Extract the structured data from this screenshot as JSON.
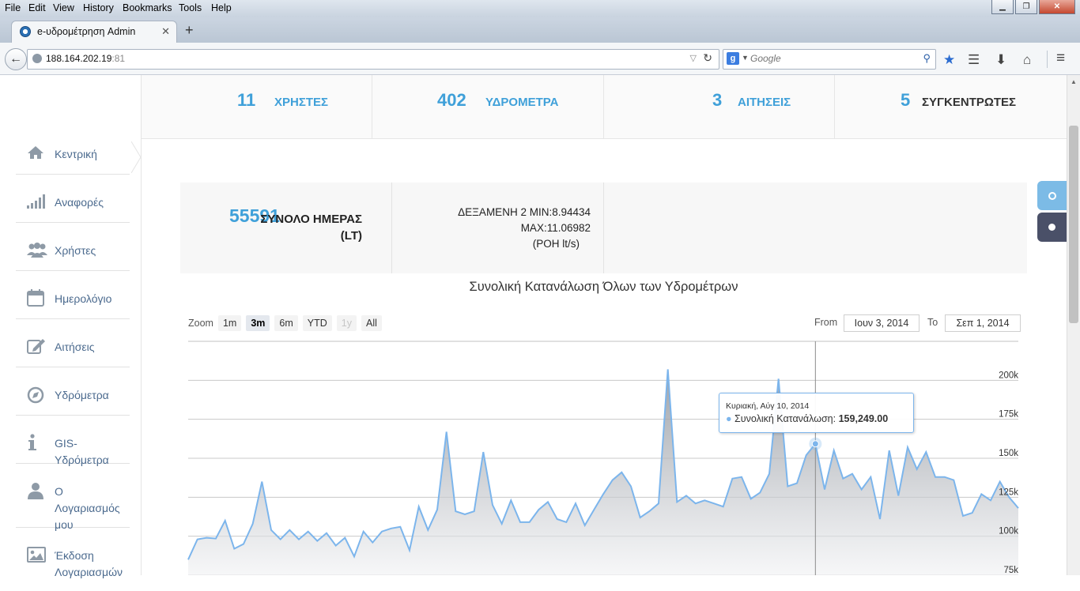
{
  "browser": {
    "menu": [
      "File",
      "Edit",
      "View",
      "History",
      "Bookmarks",
      "Tools",
      "Help"
    ],
    "tab_title": "e-υδρομέτρηση Admin",
    "url_host": "188.164.202.19",
    "url_port": ":81",
    "search_placeholder": "Google"
  },
  "stats": [
    {
      "num": "11",
      "label": "ΧΡΗΣΤΕΣ"
    },
    {
      "num": "402",
      "label": "ΥΔΡΟΜΕΤΡΑ"
    },
    {
      "num": "3",
      "label": "ΑΙΤΗΣΕΙΣ"
    },
    {
      "num": "5",
      "label": "ΣΥΓΚΕΝΤΡΩΤΕΣ"
    }
  ],
  "sidebar": [
    {
      "label": "Κεντρική",
      "icon": "home-icon"
    },
    {
      "label": "Αναφορές",
      "icon": "signal-bars-icon"
    },
    {
      "label": "Χρήστες",
      "icon": "users-icon"
    },
    {
      "label": "Ημερολόγιο",
      "icon": "calendar-icon"
    },
    {
      "label": "Αιτήσεις",
      "icon": "edit-icon"
    },
    {
      "label": "Υδρόμετρα",
      "icon": "compass-icon"
    },
    {
      "label": "GIS-Υδρόμετρα",
      "icon": "info-icon"
    },
    {
      "label": "Ο Λογαριασμός μου",
      "icon": "user-icon"
    },
    {
      "label": "Έκδοση Λογαριασμών",
      "icon": "picture-icon"
    }
  ],
  "summary": {
    "total_value": "55591",
    "total_label": "ΣΥΝΟΛΟ ΗΜΕΡΑΣ (LT)",
    "tank_line1": "ΔΕΞΑΜΕΝΗ 2 MIN:8.94434",
    "tank_line2": "MAX:11.06982",
    "tank_line3": "(ΡΟΗ lt/s)"
  },
  "zoom": {
    "label": "Zoom",
    "buttons": [
      "1m",
      "3m",
      "6m",
      "YTD",
      "1y",
      "All"
    ],
    "active": "3m",
    "disabled": "1y",
    "from_label": "From",
    "from_value": "Ιουν 3, 2014",
    "to_label": "To",
    "to_value": "Σεπ 1, 2014"
  },
  "colors": {
    "accent": "#3fa0d9",
    "series": "#7cb5ec",
    "dark_button": "#4a5068"
  },
  "chart_data": {
    "type": "area",
    "title": "Συνολική Κατανάλωση Όλων των Υδρομέτρων",
    "x_start": "2014-06-03",
    "x_end": "2014-09-01",
    "ylim": [
      75000,
      225000
    ],
    "y_ticks": [
      "75k",
      "100k",
      "125k",
      "150k",
      "175k",
      "200k"
    ],
    "y_tick_values": [
      75000,
      100000,
      125000,
      150000,
      175000,
      200000
    ],
    "grid": true,
    "series": [
      {
        "name": "Συνολική Κατανάλωση",
        "values": [
          85000,
          98000,
          99000,
          98500,
          110000,
          92000,
          95000,
          108000,
          135000,
          104000,
          98000,
          104000,
          98000,
          103000,
          97000,
          102000,
          94000,
          99000,
          87000,
          103000,
          96000,
          103000,
          105000,
          106000,
          91000,
          119000,
          104000,
          117000,
          167000,
          116000,
          114000,
          116000,
          154000,
          120000,
          108000,
          123000,
          109000,
          109000,
          117000,
          122000,
          111000,
          109000,
          121000,
          107000,
          117000,
          127000,
          136000,
          141000,
          132000,
          112000,
          116000,
          121000,
          207000,
          122000,
          126000,
          121000,
          123000,
          121000,
          119000,
          137000,
          138000,
          124000,
          128000,
          140000,
          201000,
          132000,
          134000,
          152000,
          159249,
          130000,
          155000,
          137000,
          140000,
          130000,
          138000,
          111000,
          155000,
          126000,
          157000,
          143000,
          154000,
          138000,
          138000,
          136000,
          113000,
          115000,
          127000,
          123000,
          135000,
          125000,
          118000
        ]
      }
    ],
    "tooltip": {
      "date": "Κυριακή, Αύγ 10, 2014",
      "series": "Συνολική Κατανάλωση:",
      "value": "159,249.00"
    }
  }
}
